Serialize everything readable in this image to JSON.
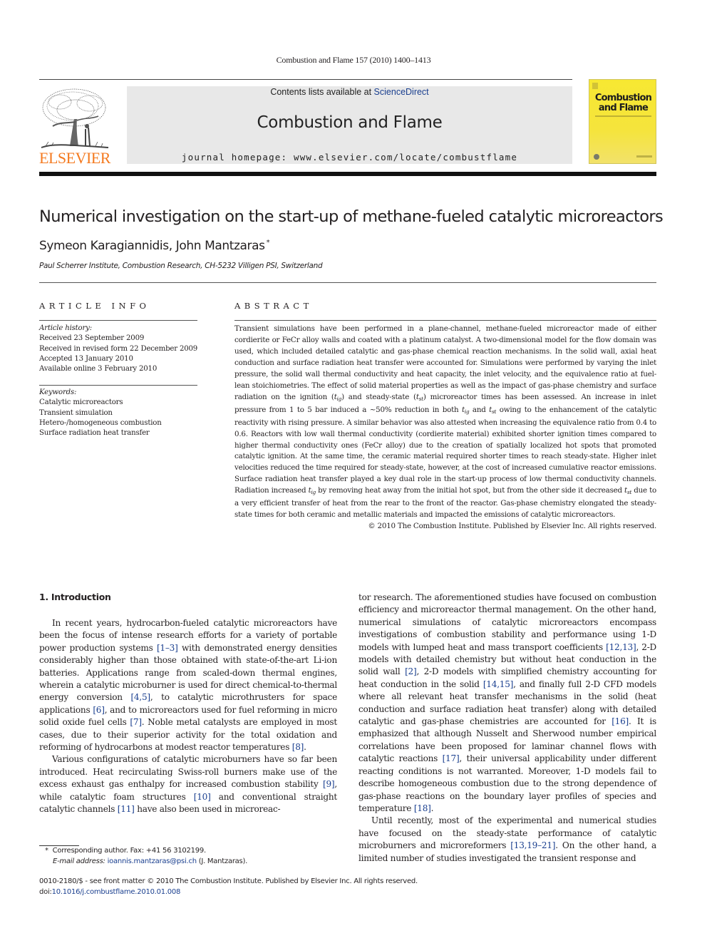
{
  "running_head": "Combustion and Flame 157 (2010) 1400–1413",
  "masthead": {
    "publisher_logo_text": "ELSEVIER",
    "contents_prefix": "Contents lists available at ",
    "contents_link": "ScienceDirect",
    "journal_title": "Combustion and Flame",
    "homepage": "journal homepage: www.elsevier.com/locate/combustflame",
    "cover_title_line1": "Combustion",
    "cover_title_line2": "and Flame",
    "colors": {
      "elsevier_orange": "#f47a20",
      "cover_yellow": "#f7e832",
      "link_blue": "#1a3f8f",
      "banner_gray": "#e8e8e8"
    }
  },
  "article": {
    "title": "Numerical investigation on the start-up of methane-fueled catalytic microreactors",
    "authors": "Symeon Karagiannidis, John Mantzaras",
    "author_mark": "*",
    "affiliation": "Paul Scherrer Institute, Combustion Research, CH-5232 Villigen PSI, Switzerland"
  },
  "article_info": {
    "label": "ARTICLE INFO",
    "history_label": "Article history:",
    "history": [
      "Received 23 September 2009",
      "Received in revised form 22 December 2009",
      "Accepted 13 January 2010",
      "Available online 3 February 2010"
    ],
    "keywords_label": "Keywords:",
    "keywords": [
      "Catalytic microreactors",
      "Transient simulation",
      "Hetero-/homogeneous combustion",
      "Surface radiation heat transfer"
    ]
  },
  "abstract": {
    "label": "ABSTRACT",
    "s1": "Transient simulations have been performed in a plane-channel, methane-fueled microreactor made of either cordierite or FeCr alloy walls and coated with a platinum catalyst. A two-dimensional model for the flow domain was used, which included detailed catalytic and gas-phase chemical reaction mechanisms. In the solid wall, axial heat conduction and surface radiation heat transfer were accounted for. Simulations were performed by varying the inlet pressure, the solid wall thermal conductivity and heat capacity, the inlet velocity, and the equivalence ratio at fuel-lean stoichiometries. The effect of solid material properties as well as the impact of gas-phase chemistry and surface radiation on the ignition (",
    "t": "t",
    "ig": "ig",
    "st": "st",
    "s2": ") and steady-state (",
    "s3": ") microreactor times has been assessed. An increase in inlet pressure from 1 to 5 bar induced a ∼50% reduction in both ",
    "s4": " and ",
    "s5": " owing to the enhancement of the catalytic reactivity with rising pressure. A similar behavior was also attested when increasing the equivalence ratio from 0.4 to 0.6. Reactors with low wall thermal conductivity (cordierite material) exhibited shorter ignition times compared to higher thermal conductivity ones (FeCr alloy) due to the creation of spatially localized hot spots that promoted catalytic ignition. At the same time, the ceramic material required shorter times to reach steady-state. Higher inlet velocities reduced the time required for steady-state, however, at the cost of increased cumulative reactor emissions. Surface radiation heat transfer played a key dual role in the start-up process of low thermal conductivity channels. Radiation increased ",
    "s6": " by removing heat away from the initial hot spot, but from the other side it decreased ",
    "s7": " due to a very efficient transfer of heat from the rear to the front of the reactor. Gas-phase chemistry elongated the steady-state times for both ceramic and metallic materials and impacted the emissions of catalytic microreactors.",
    "copyright": "© 2010 The Combustion Institute. Published by Elsevier Inc. All rights reserved."
  },
  "introduction": {
    "heading": "1. Introduction",
    "p1": [
      "In recent years, hydrocarbon-fueled catalytic microreactors have been the focus of intense research efforts for a variety of portable power production systems ",
      "[1–3]",
      " with demonstrated energy densities considerably higher than those obtained with state-of-the-art Li-ion batteries. Applications range from scaled-down thermal engines, wherein a catalytic microburner is used for direct chemical-to-thermal energy conversion ",
      "[4,5]",
      ", to catalytic microthrusters for space applications ",
      "[6]",
      ", and to microreactors used for fuel reforming in micro solid oxide fuel cells ",
      "[7]",
      ". Noble metal catalysts are employed in most cases, due to their superior activity for the total oxidation and reforming of hydrocarbons at modest reactor temperatures ",
      "[8]",
      "."
    ],
    "p2": [
      "Various configurations of catalytic microburners have so far been introduced. Heat recirculating Swiss-roll burners make use of the excess exhaust gas enthalpy for increased combustion stability ",
      "[9]",
      ", while catalytic foam structures ",
      "[10]",
      " and conventional straight catalytic channels ",
      "[11]",
      " have also been used in microreactor research. The aforementioned studies have focused on combustion efficiency and microreactor thermal management. On the other hand, numerical simulations of catalytic microreactors encompass investigations of combustion stability and performance using 1-D models with lumped heat and mass transport coefficients ",
      "[12,13]",
      ", 2-D models with detailed chemistry but without heat conduction in the solid wall ",
      "[2]",
      ", 2-D models with simplified chemistry accounting for heat conduction in the solid ",
      "[14,15]",
      ", and finally full 2-D CFD models where all relevant heat transfer mechanisms in the solid (heat conduction and surface radiation heat transfer) along with detailed catalytic and gas-phase chemistries are accounted for ",
      "[16]",
      ". It is emphasized that although Nusselt and Sherwood number empirical correlations have been proposed for laminar channel flows with catalytic reactions ",
      "[17]",
      ", their universal applicability under different reacting conditions is not warranted. Moreover, 1-D models fail to describe homogeneous combustion due to the strong dependence of gas-phase reactions on the boundary layer profiles of species and temperature ",
      "[18]",
      "."
    ],
    "p3": [
      "Until recently, most of the experimental and numerical studies have focused on the steady-state performance of catalytic microburners and microreformers ",
      "[13,19–21]",
      ". On the other hand, a limited number of studies investigated the transient response and"
    ]
  },
  "footnote": {
    "mark": "*",
    "corresponding": "Corresponding author. Fax: +41 56 3102199.",
    "email_label": "E-mail address:",
    "email": "ioannis.mantzaras@psi.ch",
    "email_suffix": "(J. Mantzaras)."
  },
  "bottom": {
    "issn_line": "0010-2180/$ - see front matter © 2010 The Combustion Institute. Published by Elsevier Inc. All rights reserved.",
    "doi_label": "doi:",
    "doi": "10.1016/j.combustflame.2010.01.008"
  }
}
